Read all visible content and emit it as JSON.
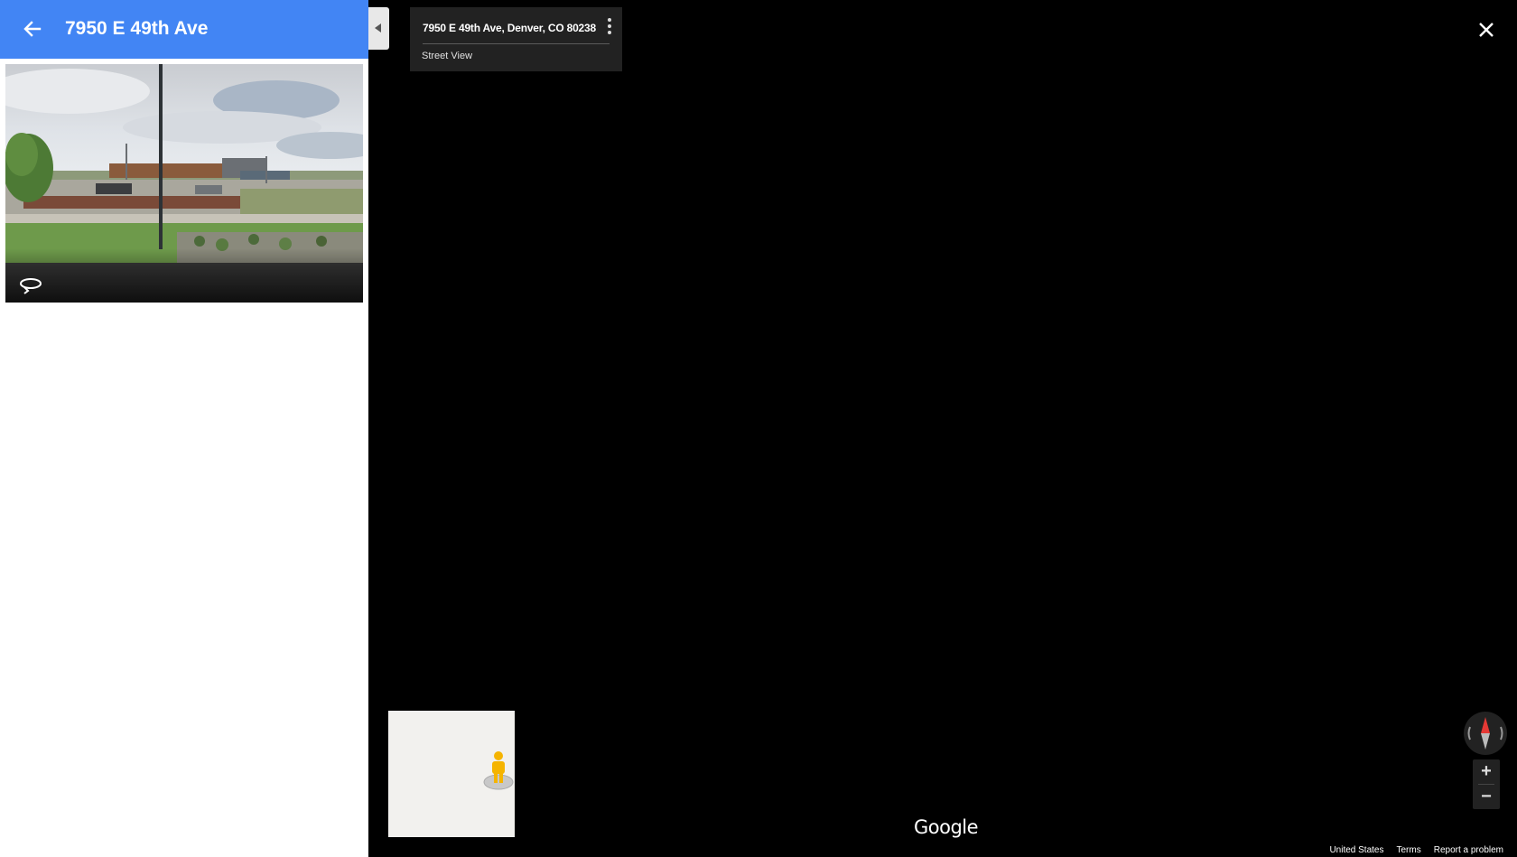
{
  "side_panel": {
    "title": "7950 E 49th Ave"
  },
  "address_card": {
    "address": "7950 E 49th Ave, Denver, CO 80238",
    "subtitle": "Street View"
  },
  "branding": {
    "logo_text": "Google"
  },
  "footer": {
    "country": "United States",
    "terms": "Terms",
    "report": "Report a problem"
  },
  "colors": {
    "header_blue": "#4285f4",
    "background": "#000000",
    "card": "#222222",
    "compass_needle": "#e53935"
  },
  "icons": {
    "back": "arrow-left-icon",
    "rotate": "rotate-360-icon",
    "collapse": "triangle-left-icon",
    "menu": "more-vert-icon",
    "close": "close-icon",
    "pegman": "pegman-icon",
    "compass": "compass-icon"
  }
}
